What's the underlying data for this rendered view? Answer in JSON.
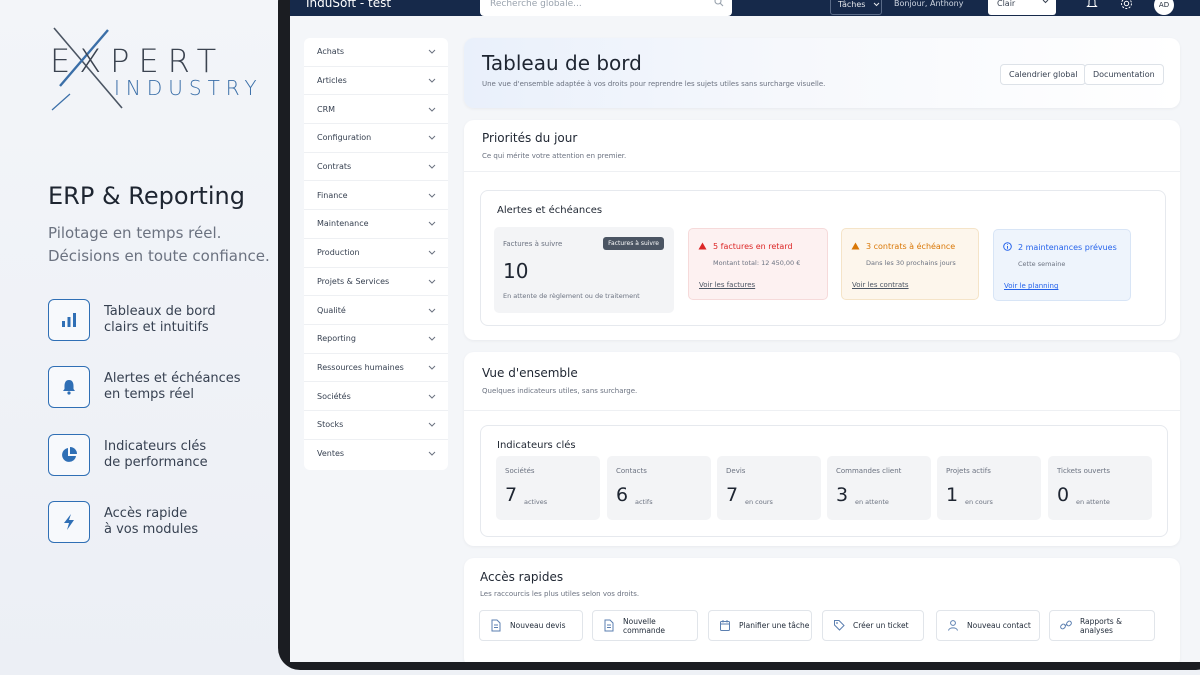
{
  "promo": {
    "logo_top": "EXPERT",
    "logo_bottom": "INDUSTRY",
    "title": "ERP & Reporting",
    "subtitle_line1": "Pilotage en temps réel.",
    "subtitle_line2": "Décisions en toute confiance.",
    "features": [
      {
        "line1": "Tableaux de bord",
        "line2": "clairs et intuitifs",
        "icon": "bar-chart-icon"
      },
      {
        "line1": "Alertes et échéances",
        "line2": "en temps réel",
        "icon": "bell-icon"
      },
      {
        "line1": "Indicateurs clés",
        "line2": "de performance",
        "icon": "pie-chart-icon"
      },
      {
        "line1": "Accès rapide",
        "line2": "à vos modules",
        "icon": "lightning-icon"
      }
    ],
    "accent": "#2f6fb5"
  },
  "topbar": {
    "app_title": "InduSoft - test",
    "search_placeholder": "Recherche globale...",
    "tasks_label": "Tâches",
    "greeting": "Bonjour, Anthony",
    "theme_value": "Clair",
    "avatar_initials": "AD",
    "background": "#16294a"
  },
  "sidebar": {
    "items": [
      "Achats",
      "Articles",
      "CRM",
      "Configuration",
      "Contrats",
      "Finance",
      "Maintenance",
      "Production",
      "Projets & Services",
      "Qualité",
      "Reporting",
      "Ressources humaines",
      "Sociétés",
      "Stocks",
      "Ventes"
    ]
  },
  "header": {
    "title": "Tableau de bord",
    "subtitle": "Une vue d'ensemble adaptée à vos droits pour reprendre les sujets utiles sans surcharge visuelle.",
    "btn_calendar": "Calendrier global",
    "btn_docs": "Documentation"
  },
  "priorities": {
    "title": "Priorités du jour",
    "subtitle": "Ce qui mérite votre attention en premier.",
    "alerts_title": "Alertes et échéances",
    "invoices": {
      "label": "Factures à suivre",
      "badge": "Factures à suivre",
      "value": "10",
      "note": "En attente de règlement ou de traitement"
    },
    "late": {
      "title": "5 factures en retard",
      "desc": "Montant total: 12 450,00 €",
      "link": "Voir les factures",
      "color": "#dc2626"
    },
    "contracts": {
      "title": "3 contrats à échéance",
      "desc": "Dans les 30 prochains jours",
      "link": "Voir les contrats",
      "color": "#d97706"
    },
    "maintenance": {
      "title": "2 maintenances prévues",
      "desc": "Cette semaine",
      "link": "Voir le planning",
      "color": "#2563eb"
    }
  },
  "overview": {
    "title": "Vue d'ensemble",
    "subtitle": "Quelques indicateurs utiles, sans surcharge.",
    "kpi_title": "Indicateurs clés",
    "kpis": [
      {
        "label": "Sociétés",
        "value": "7",
        "unit": "actives"
      },
      {
        "label": "Contacts",
        "value": "6",
        "unit": "actifs"
      },
      {
        "label": "Devis",
        "value": "7",
        "unit": "en cours"
      },
      {
        "label": "Commandes client",
        "value": "3",
        "unit": "en attente"
      },
      {
        "label": "Projets actifs",
        "value": "1",
        "unit": "en cours"
      },
      {
        "label": "Tickets ouverts",
        "value": "0",
        "unit": "en attente"
      }
    ]
  },
  "quick": {
    "title": "Accès rapides",
    "subtitle": "Les raccourcis les plus utiles selon vos droits.",
    "actions": [
      {
        "label": "Nouveau devis",
        "icon": "document-icon"
      },
      {
        "label": "Nouvelle commande",
        "icon": "document-icon"
      },
      {
        "label": "Planifier une tâche",
        "icon": "calendar-icon"
      },
      {
        "label": "Créer un ticket",
        "icon": "tag-icon"
      },
      {
        "label": "Nouveau contact",
        "icon": "user-icon"
      },
      {
        "label": "Rapports & analyses",
        "icon": "link-icon"
      }
    ]
  }
}
